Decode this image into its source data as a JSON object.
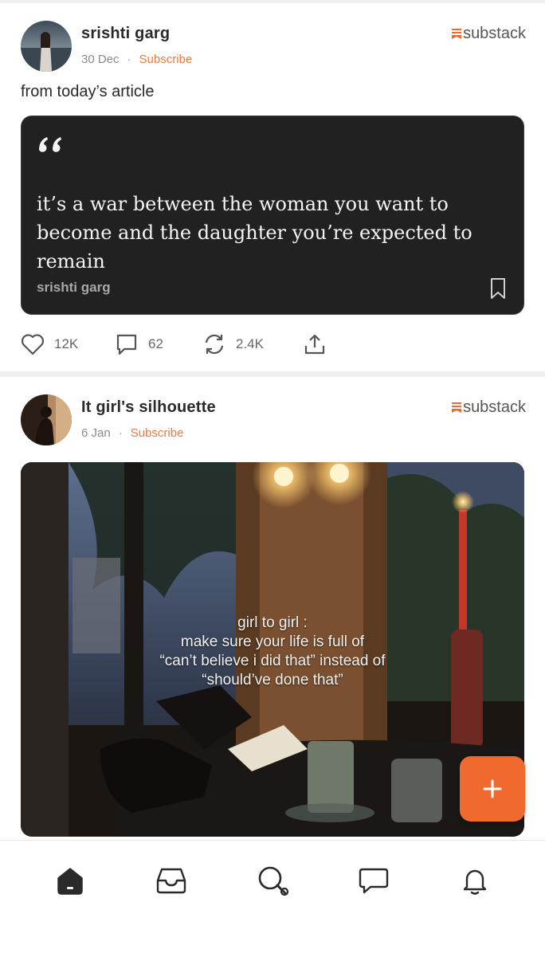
{
  "posts": [
    {
      "author": "srishti garg",
      "date": "30 Dec",
      "subscribe_label": "Subscribe",
      "brand": "substack",
      "text": "from today’s article",
      "quote": {
        "text": "it’s a war between the woman you want to become and the daughter you’re expected to remain",
        "author": "srishti garg"
      },
      "actions": {
        "likes": "12K",
        "comments": "62",
        "restacks": "2.4K"
      }
    },
    {
      "author": "It girl's silhouette",
      "date": "6 Jan",
      "subscribe_label": "Subscribe",
      "brand": "substack",
      "image_caption": [
        "girl to girl :",
        "make sure your life is full of",
        "“can’t believe i did that” instead of",
        "“should’ve done that”"
      ]
    }
  ],
  "fab": {
    "icon": "plus-icon"
  },
  "nav": [
    "home-icon",
    "inbox-icon",
    "search-icon",
    "chat-icon",
    "bell-icon"
  ],
  "colors": {
    "accent": "#f0692e",
    "card": "#212121",
    "subscribe": "#ee7a3a"
  }
}
